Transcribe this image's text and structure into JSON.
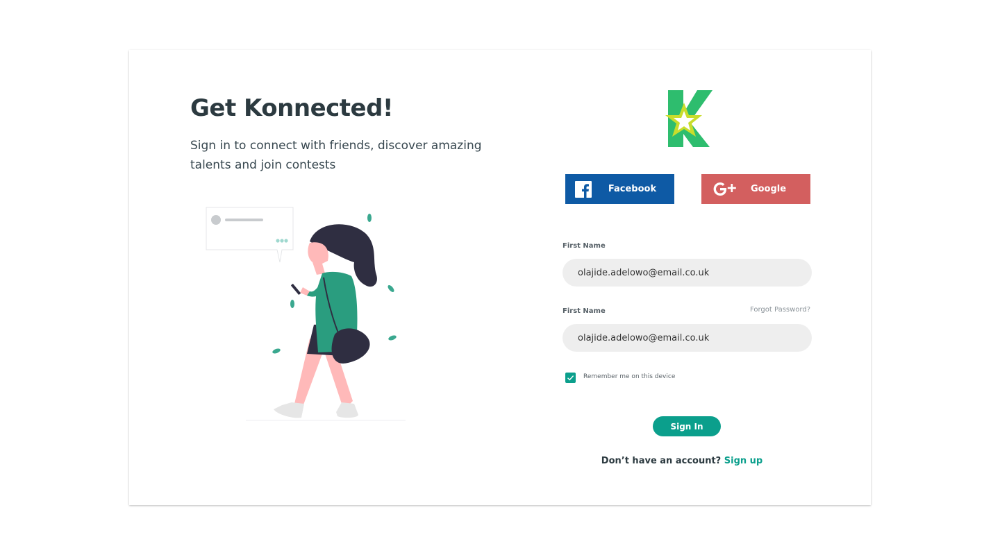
{
  "hero": {
    "title": "Get Konnected!",
    "subtitle": "Sign in to connect with friends, discover amazing talents and join contests"
  },
  "logo": {
    "icon": "konnect-star-logo-icon"
  },
  "social": {
    "facebook_label": "Facebook",
    "google_label": "Google"
  },
  "form": {
    "field1_label": "First Name",
    "field1_value": "olajide.adelowo@email.co.uk",
    "field2_label": "First Name",
    "field2_value": "olajide.adelowo@email.co.uk",
    "forgot_password": "Forgot Password?",
    "remember_label": "Remember me on this device",
    "remember_checked": true,
    "signin_label": "Sign In"
  },
  "footer": {
    "prompt": "Don’t have an account?",
    "signup_link": "Sign up"
  },
  "colors": {
    "accent": "#0b9f8c",
    "facebook": "#0e5aa5",
    "google": "#d35f5f",
    "heading": "#2c3a40"
  }
}
